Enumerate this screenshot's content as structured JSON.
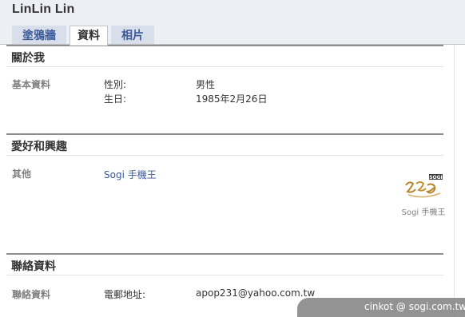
{
  "profile": {
    "name": "LinLin Lin"
  },
  "tabs": [
    {
      "label": "塗鴉牆",
      "active": false
    },
    {
      "label": "資料",
      "active": true
    },
    {
      "label": "相片",
      "active": false
    }
  ],
  "sections": {
    "about": {
      "title": "關於我",
      "row_label": "基本資料",
      "fields": [
        {
          "label": "性別:",
          "value": "男性"
        },
        {
          "label": "生日:",
          "value": "1985年2月26日"
        }
      ]
    },
    "interests": {
      "title": "愛好和興趣",
      "row_label": "其他",
      "link": "Sogi 手機王",
      "logo_caption": "Sogi 手機王",
      "logo_text": "手機王",
      "logo_badge": "SOGI"
    },
    "contact": {
      "title": "聯絡資料",
      "row_label": "聯絡資料",
      "fields": [
        {
          "label": "電郵地址:",
          "value": "apop231@yahoo.com.tw"
        }
      ]
    }
  },
  "watermark": {
    "text": "cinkot  @ sogi.com.tw"
  },
  "colors": {
    "header_bg": "#edeff4",
    "tab_bg": "#d8dfea",
    "link": "#3b5998",
    "muted_label": "#808080",
    "section_rule": "#8e8e8e"
  }
}
